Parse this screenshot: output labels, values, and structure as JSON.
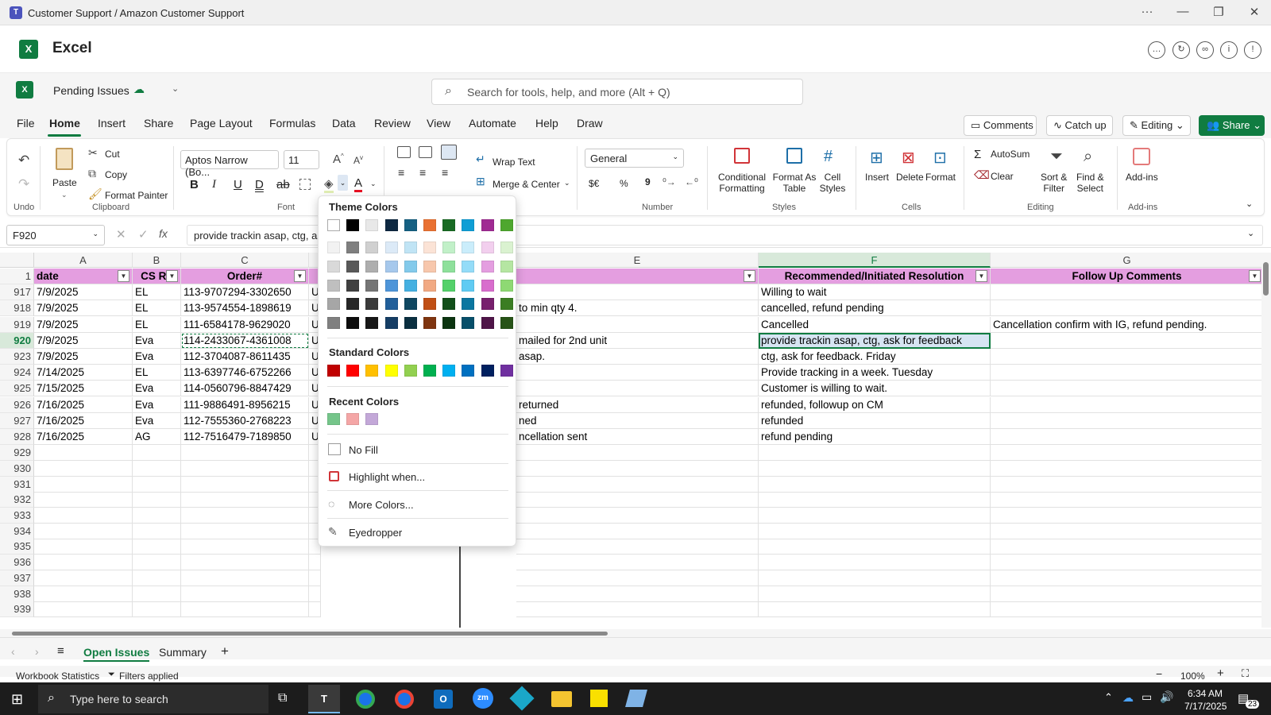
{
  "titlebar": {
    "title": "Customer Support / Amazon Customer Support"
  },
  "app": {
    "name": "Excel"
  },
  "file": {
    "name": "Pending Issues"
  },
  "search": {
    "placeholder": "Search for tools, help, and more (Alt + Q)"
  },
  "menu_tabs": [
    "File",
    "Home",
    "Insert",
    "Share",
    "Page Layout",
    "Formulas",
    "Data",
    "Review",
    "View",
    "Automate",
    "Help",
    "Draw"
  ],
  "actions": {
    "comments": "Comments",
    "catchup": "Catch up",
    "editing": "Editing",
    "share": "Share"
  },
  "ribbon": {
    "undo_group": "Undo",
    "clipboard": {
      "paste": "Paste",
      "cut": "Cut",
      "copy": "Copy",
      "format_painter": "Format Painter",
      "group": "Clipboard"
    },
    "font": {
      "name": "Aptos Narrow (Bo...",
      "size": "11",
      "group": "Font"
    },
    "alignment": {
      "wrap": "Wrap Text",
      "merge": "Merge & Center"
    },
    "number": {
      "format": "General",
      "currency": "$€",
      "percent": "%",
      "comma": "9",
      "group": "Number"
    },
    "styles": {
      "conditional": "Conditional",
      "conditional2": "Formatting",
      "format_table": "Format As",
      "format_table2": "Table",
      "cell_styles": "Cell",
      "cell_styles2": "Styles",
      "group": "Styles"
    },
    "cells": {
      "insert": "Insert",
      "delete": "Delete",
      "format": "Format",
      "group": "Cells"
    },
    "editing": {
      "autosum": "AutoSum",
      "clear": "Clear",
      "sort": "Sort &",
      "sort2": "Filter",
      "find": "Find &",
      "find2": "Select",
      "group": "Editing"
    },
    "addins": {
      "label": "Add-ins",
      "group": "Add-ins"
    }
  },
  "formula_bar": {
    "name_box": "F920",
    "formula": "provide trackin asap, ctg, ask"
  },
  "columns": {
    "A": "A",
    "B": "B",
    "C": "C",
    "E": "E",
    "F": "F",
    "G": "G"
  },
  "header_row": {
    "num": "1",
    "a": "date",
    "b": "CS Re",
    "c": "Order#",
    "f": "Recommended/Initiated Resolution",
    "g": "Follow Up Comments"
  },
  "rows": [
    {
      "num": "917",
      "a": "7/9/2025",
      "b": "EL",
      "c": "113-9707294-3302650",
      "d": "US",
      "e": "",
      "f": "Willing to wait",
      "g": ""
    },
    {
      "num": "918",
      "a": "7/9/2025",
      "b": "EL",
      "c": "113-9574554-1898619",
      "d": "US",
      "e": "to min qty 4.",
      "f": "cancelled, refund pending",
      "g": ""
    },
    {
      "num": "919",
      "a": "7/9/2025",
      "b": "EL",
      "c": "111-6584178-9629020",
      "d": "US",
      "e": "",
      "f": "Cancelled",
      "g": "Cancellation confirm with IG, refund pending."
    },
    {
      "num": "920",
      "a": "7/9/2025",
      "b": "Eva",
      "c": "114-2433067-4361008",
      "d": "US",
      "e": "mailed for 2nd unit",
      "f": "provide trackin asap, ctg, ask for feedback",
      "g": ""
    },
    {
      "num": "923",
      "a": "7/9/2025",
      "b": "Eva",
      "c": "112-3704087-8611435",
      "d": "US",
      "e": "asap.",
      "f": "ctg, ask for feedback. Friday",
      "g": ""
    },
    {
      "num": "924",
      "a": "7/14/2025",
      "b": "EL",
      "c": "113-6397746-6752266",
      "d": "US",
      "e": "",
      "f": "Provide tracking in a week. Tuesday",
      "g": ""
    },
    {
      "num": "925",
      "a": "7/15/2025",
      "b": "Eva",
      "c": "114-0560796-8847429",
      "d": "US",
      "e": "",
      "f": "Customer is willing to wait.",
      "g": ""
    },
    {
      "num": "926",
      "a": "7/16/2025",
      "b": "Eva",
      "c": "111-9886491-8956215",
      "d": "US",
      "e": "returned",
      "f": "refunded, followup on CM",
      "g": ""
    },
    {
      "num": "927",
      "a": "7/16/2025",
      "b": "Eva",
      "c": "112-7555360-2768223",
      "d": "US",
      "e": "ned",
      "f": "refunded",
      "g": ""
    },
    {
      "num": "928",
      "a": "7/16/2025",
      "b": "AG",
      "c": "112-7516479-7189850",
      "d": "US",
      "e": "ncellation sent",
      "f": "refund pending",
      "g": ""
    }
  ],
  "empty_rows": [
    "929",
    "930",
    "931",
    "932",
    "933",
    "934",
    "935",
    "936",
    "937",
    "938",
    "939"
  ],
  "fill_popup": {
    "theme_title": "Theme Colors",
    "theme_top": [
      "#ffffff",
      "#000000",
      "#e8e8e8",
      "#0e2841",
      "#156082",
      "#e97132",
      "#196b24",
      "#0f9ed5",
      "#a02b93",
      "#4ea72e"
    ],
    "theme_shades": [
      [
        "#f2f2f2",
        "#7f7f7f",
        "#d0d0d0",
        "#dceaf7",
        "#c0e4f5",
        "#fbe3d6",
        "#c1f0c8",
        "#caedfb",
        "#f2cfee",
        "#daf2d0"
      ],
      [
        "#d9d9d9",
        "#595959",
        "#aeaeae",
        "#a6c8ec",
        "#83caeb",
        "#f7c7ac",
        "#8ee09b",
        "#94dcf8",
        "#e49ee0",
        "#b5e6a2"
      ],
      [
        "#bfbfbf",
        "#404040",
        "#757575",
        "#4e95d9",
        "#45b0e1",
        "#f1a983",
        "#54d16a",
        "#60cbf3",
        "#d86dcd",
        "#8ed973"
      ],
      [
        "#a6a6a6",
        "#262626",
        "#3a3a3a",
        "#215f9a",
        "#0f4761",
        "#c04f15",
        "#124f1a",
        "#0b76a0",
        "#77206d",
        "#3b7d23"
      ],
      [
        "#808080",
        "#0d0d0d",
        "#171717",
        "#153d64",
        "#0a2f40",
        "#7f3510",
        "#0c3511",
        "#074f6a",
        "#4f1548",
        "#275317"
      ]
    ],
    "standard_title": "Standard Colors",
    "standard": [
      "#c00000",
      "#ff0000",
      "#ffc000",
      "#ffff00",
      "#92d050",
      "#00b050",
      "#00b0f0",
      "#0070c0",
      "#002060",
      "#7030a0"
    ],
    "recent_title": "Recent Colors",
    "recent": [
      "#75c58a",
      "#f4a6a6",
      "#c3a8d8"
    ],
    "no_fill": "No Fill",
    "highlight": "Highlight when...",
    "more_colors": "More Colors...",
    "eyedropper": "Eyedropper"
  },
  "sheets": {
    "open_issues": "Open Issues",
    "summary": "Summary"
  },
  "statusbar": {
    "stats": "Workbook Statistics",
    "filters": "Filters applied",
    "zoom": "100%"
  },
  "taskbar": {
    "search": "Type here to search",
    "time": "6:34 AM",
    "date": "7/17/2025",
    "notif": "23"
  }
}
